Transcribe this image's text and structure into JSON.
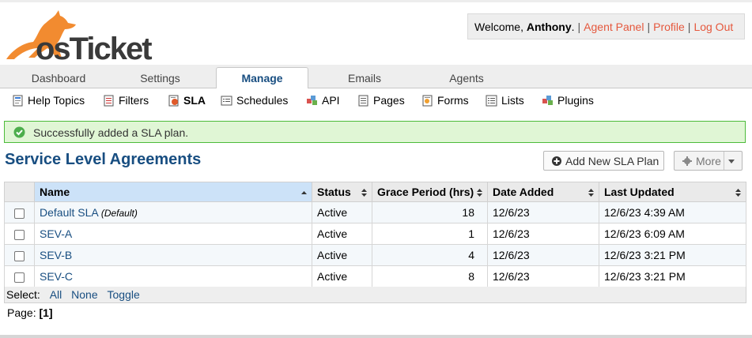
{
  "brand": {
    "logo_text": "osTicket"
  },
  "user_bar": {
    "welcome_prefix": "Welcome, ",
    "user_name": "Anthony",
    "welcome_suffix": ".",
    "agent_panel": "Agent Panel",
    "profile": "Profile",
    "logout": "Log Out",
    "separator": "|"
  },
  "nav": {
    "tabs": [
      {
        "label": "Dashboard"
      },
      {
        "label": "Settings"
      },
      {
        "label": "Manage",
        "active": true
      },
      {
        "label": "Emails"
      },
      {
        "label": "Agents"
      }
    ]
  },
  "subnav": {
    "items": [
      {
        "label": "Help Topics",
        "icon": "help-topics-icon"
      },
      {
        "label": "Filters",
        "icon": "filters-icon"
      },
      {
        "label": "SLA",
        "icon": "sla-icon",
        "active": true
      },
      {
        "label": "Schedules",
        "icon": "schedules-icon"
      },
      {
        "label": "API",
        "icon": "api-icon"
      },
      {
        "label": "Pages",
        "icon": "pages-icon"
      },
      {
        "label": "Forms",
        "icon": "forms-icon"
      },
      {
        "label": "Lists",
        "icon": "lists-icon"
      },
      {
        "label": "Plugins",
        "icon": "plugins-icon"
      }
    ]
  },
  "message": {
    "text": "Successfully added a SLA plan."
  },
  "page": {
    "title": "Service Level Agreements",
    "add_button": "Add New SLA Plan",
    "more_button": "More"
  },
  "table": {
    "headers": [
      "Name",
      "Status",
      "Grace Period (hrs)",
      "Date Added",
      "Last Updated"
    ],
    "rows": [
      {
        "name": "Default SLA",
        "default_tag": "(Default)",
        "status": "Active",
        "grace": "18",
        "added": "12/6/23",
        "updated": "12/6/23 4:39 AM"
      },
      {
        "name": "SEV-A",
        "default_tag": "",
        "status": "Active",
        "grace": "1",
        "added": "12/6/23",
        "updated": "12/6/23 6:09 AM"
      },
      {
        "name": "SEV-B",
        "default_tag": "",
        "status": "Active",
        "grace": "4",
        "added": "12/6/23",
        "updated": "12/6/23 3:21 PM"
      },
      {
        "name": "SEV-C",
        "default_tag": "",
        "status": "Active",
        "grace": "8",
        "added": "12/6/23",
        "updated": "12/6/23 3:21 PM"
      }
    ]
  },
  "selection": {
    "label": "Select:",
    "all": "All",
    "none": "None",
    "toggle": "Toggle"
  },
  "pager": {
    "label": "Page:",
    "current": "[1]"
  },
  "colors": {
    "brand_orange": "#f28b30",
    "link_blue": "#184e81",
    "link_orange": "#e5583d",
    "success_bg": "#e0f6d5",
    "success_border": "#4cbb3a"
  }
}
